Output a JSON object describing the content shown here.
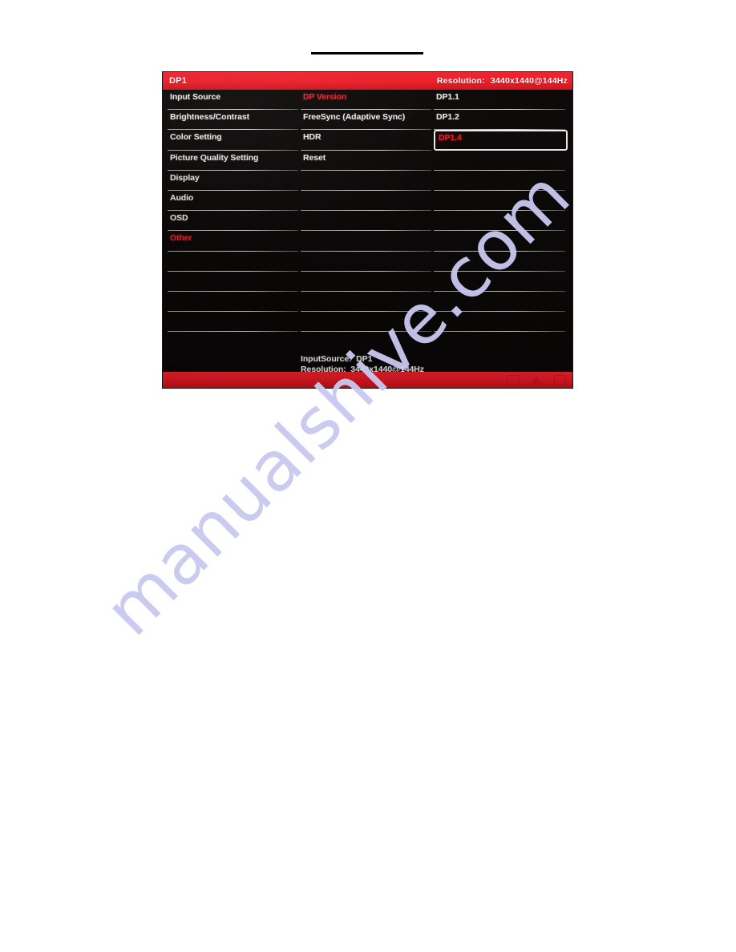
{
  "page": {
    "background_color": "#ffffff",
    "watermark_text": "manualshive.com",
    "watermark_color": "#c9c9f2",
    "rule_color": "#000000"
  },
  "osd": {
    "accent_red": "#ef1b24",
    "panel_black": "#090606",
    "titlebar": {
      "input_label": "DP1",
      "resolution_label": "Resolution:",
      "resolution_value": "3440x1440@144Hz"
    },
    "columns": {
      "menu": {
        "name": "main-menu",
        "items": [
          {
            "label": "Input Source",
            "state": "normal"
          },
          {
            "label": "Brightness/Contrast",
            "state": "normal"
          },
          {
            "label": "Color Setting",
            "state": "normal"
          },
          {
            "label": "Picture Quality Setting",
            "state": "normal"
          },
          {
            "label": "Display",
            "state": "normal"
          },
          {
            "label": "Audio",
            "state": "normal"
          },
          {
            "label": "OSD",
            "state": "normal"
          },
          {
            "label": "Other",
            "state": "active"
          },
          {
            "label": "",
            "state": "empty"
          },
          {
            "label": "",
            "state": "empty"
          },
          {
            "label": "",
            "state": "empty"
          },
          {
            "label": "",
            "state": "empty"
          },
          {
            "label": "",
            "state": "blank"
          }
        ]
      },
      "submenu": {
        "name": "other-submenu",
        "items": [
          {
            "label": "DP Version",
            "state": "active"
          },
          {
            "label": "FreeSync (Adaptive Sync)",
            "state": "normal"
          },
          {
            "label": "HDR",
            "state": "normal"
          },
          {
            "label": "Reset",
            "state": "normal"
          },
          {
            "label": "",
            "state": "empty"
          },
          {
            "label": "",
            "state": "empty"
          },
          {
            "label": "",
            "state": "empty"
          },
          {
            "label": "",
            "state": "empty"
          },
          {
            "label": "",
            "state": "empty"
          },
          {
            "label": "",
            "state": "empty"
          },
          {
            "label": "",
            "state": "empty"
          },
          {
            "label": "",
            "state": "empty"
          },
          {
            "label": "",
            "state": "blank"
          }
        ]
      },
      "options": {
        "name": "dp-version-options",
        "items": [
          {
            "label": "DP1.1",
            "state": "normal"
          },
          {
            "label": "DP1.2",
            "state": "normal"
          },
          {
            "label": "DP1.4",
            "state": "selected"
          },
          {
            "label": "",
            "state": "empty"
          },
          {
            "label": "",
            "state": "empty"
          },
          {
            "label": "",
            "state": "empty"
          },
          {
            "label": "",
            "state": "empty"
          },
          {
            "label": "",
            "state": "empty"
          },
          {
            "label": "",
            "state": "empty"
          },
          {
            "label": "",
            "state": "empty"
          },
          {
            "label": "",
            "state": "empty"
          },
          {
            "label": "",
            "state": "empty"
          },
          {
            "label": "",
            "state": "blank"
          }
        ]
      }
    },
    "info": {
      "line1": "InputSource:  DP1",
      "line2": "Resolution:  3440x1440@144Hz"
    },
    "footer": {
      "glyphs": [
        "menu-glyph",
        "up-arrow-glyph",
        "exit-glyph"
      ]
    }
  }
}
